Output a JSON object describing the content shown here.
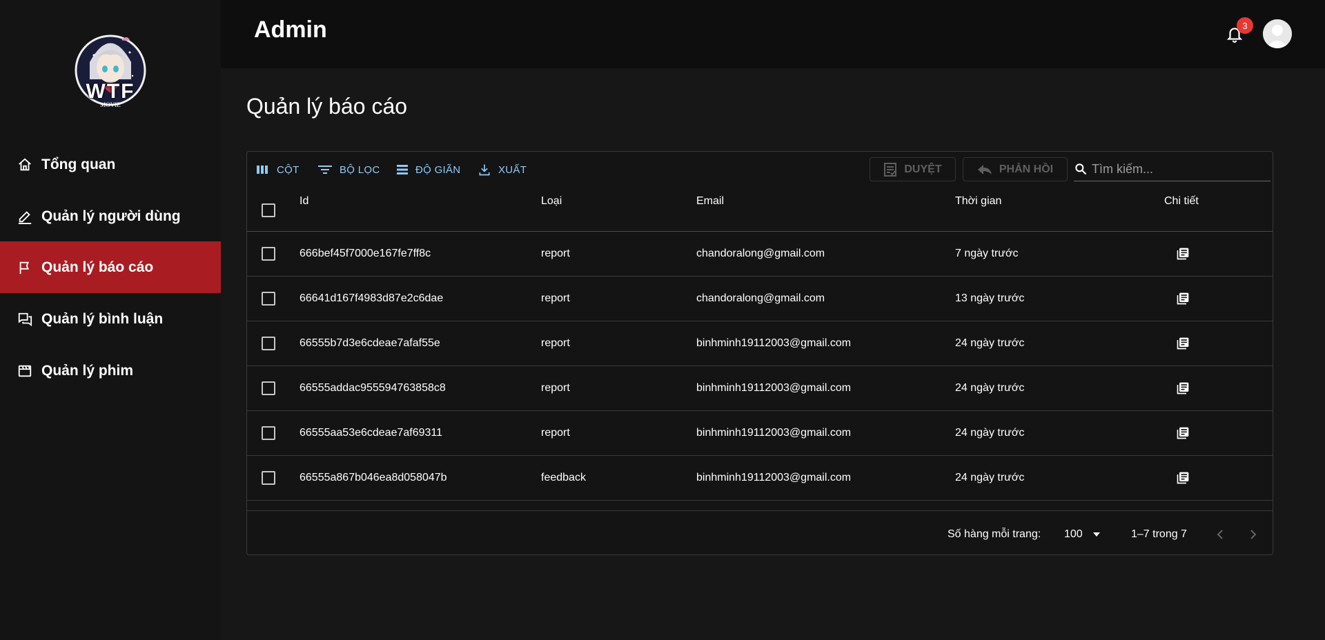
{
  "header": {
    "title": "Admin",
    "notification_count": "3"
  },
  "sidebar": {
    "logo_text": "WTF",
    "logo_subtext": "MOVIE",
    "items": [
      {
        "label": "Tổng quan",
        "icon": "home-icon",
        "active": false
      },
      {
        "label": "Quản lý người dùng",
        "icon": "edit-icon",
        "active": false
      },
      {
        "label": "Quản lý báo cáo",
        "icon": "flag-icon",
        "active": true
      },
      {
        "label": "Quản lý bình luận",
        "icon": "comments-icon",
        "active": false
      },
      {
        "label": "Quản lý phim",
        "icon": "clapperboard-icon",
        "active": false
      }
    ]
  },
  "main": {
    "page_title": "Quản lý báo cáo",
    "toolbar": {
      "columns_label": "CỘT",
      "filter_label": "BỘ LỌC",
      "density_label": "ĐỘ GIÃN",
      "export_label": "XUẤT",
      "approve_label": "DUYỆT",
      "reply_label": "PHẢN HỒI",
      "search_placeholder": "Tìm kiếm..."
    },
    "columns": [
      "Id",
      "Loại",
      "Email",
      "Thời gian",
      "Chi tiết"
    ],
    "rows": [
      {
        "id": "666bef45f7000e167fe7ff8c",
        "type": "report",
        "email": "chandoralong@gmail.com",
        "time": "7 ngày trước"
      },
      {
        "id": "66641d167f4983d87e2c6dae",
        "type": "report",
        "email": "chandoralong@gmail.com",
        "time": "13 ngày trước"
      },
      {
        "id": "66555b7d3e6cdeae7afaf55e",
        "type": "report",
        "email": "binhminh19112003@gmail.com",
        "time": "24 ngày trước"
      },
      {
        "id": "66555addac955594763858c8",
        "type": "report",
        "email": "binhminh19112003@gmail.com",
        "time": "24 ngày trước"
      },
      {
        "id": "66555aa53e6cdeae7af69311",
        "type": "report",
        "email": "binhminh19112003@gmail.com",
        "time": "24 ngày trước"
      },
      {
        "id": "66555a867b046ea8d058047b",
        "type": "feedback",
        "email": "binhminh19112003@gmail.com",
        "time": "24 ngày trước"
      }
    ],
    "pagination": {
      "rows_per_page_label": "Số hàng mỗi trang:",
      "rows_per_page_value": "100",
      "range_label": "1–7 trong 7"
    }
  },
  "colors": {
    "accent": "#a91d22",
    "link": "#90caf9",
    "badge": "#e53935"
  }
}
